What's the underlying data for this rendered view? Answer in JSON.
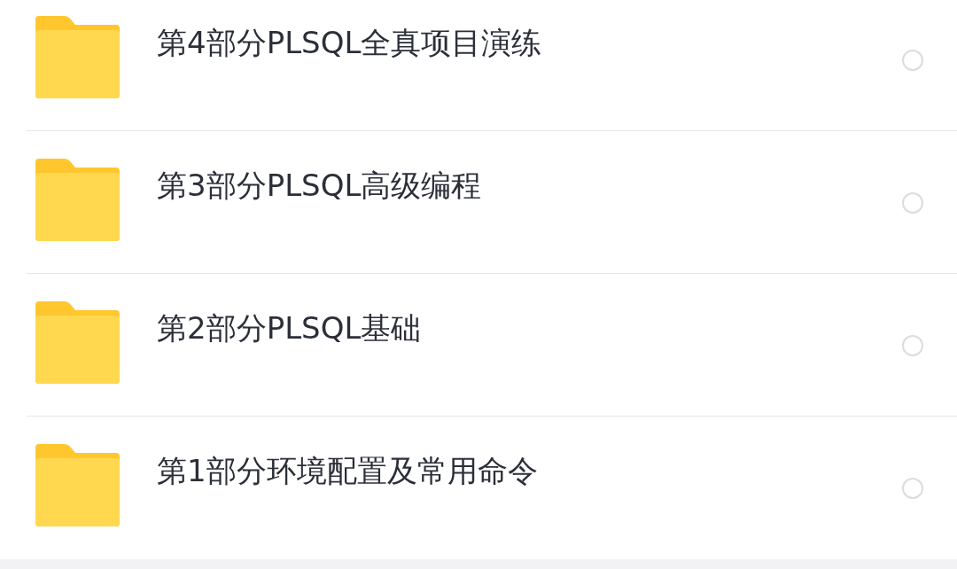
{
  "folders": [
    {
      "name": "第4部分PLSQL全真项目演练",
      "selected": false
    },
    {
      "name": "第3部分PLSQL高级编程",
      "selected": false
    },
    {
      "name": "第2部分PLSQL基础",
      "selected": false
    },
    {
      "name": "第1部分环境配置及常用命令",
      "selected": false
    }
  ]
}
